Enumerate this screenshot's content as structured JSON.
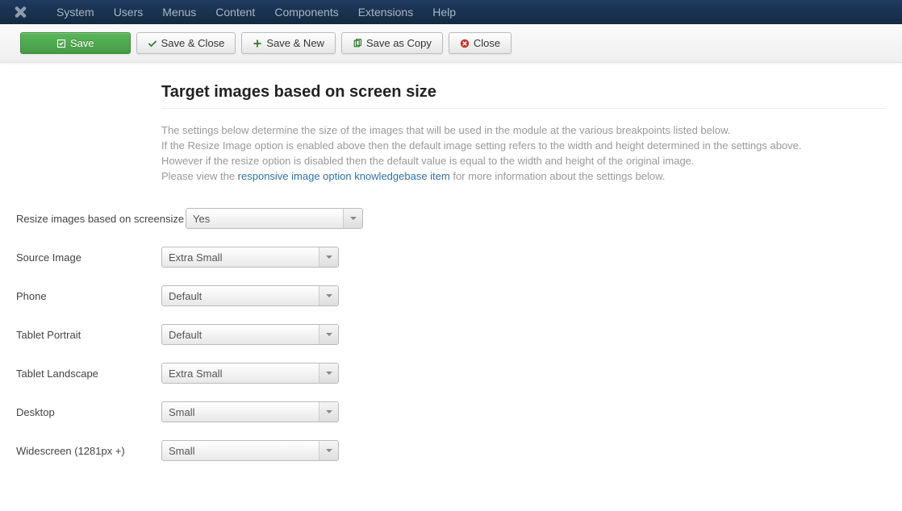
{
  "navbar": {
    "items": [
      "System",
      "Users",
      "Menus",
      "Content",
      "Components",
      "Extensions",
      "Help"
    ]
  },
  "toolbar": {
    "save": "Save",
    "save_close": "Save & Close",
    "save_new": "Save & New",
    "save_copy": "Save as Copy",
    "close": "Close"
  },
  "section": {
    "title": "Target images based on screen size",
    "desc_line1": "The settings below determine the size of the images that will be used in the module at the various breakpoints listed below.",
    "desc_line2": "If the Resize Image option is enabled above then the default image setting refers to the width and height determined in the settings above.",
    "desc_line3": "However if the resize option is disabled then the default value is equal to the width and height of the original image.",
    "desc_line4_pre": "Please view the ",
    "desc_line4_link": "responsive image option knowledgebase item",
    "desc_line4_post": " for more information about the settings below."
  },
  "form": {
    "resize_label": "Resize images based on screensize",
    "resize_value": "Yes",
    "source_label": "Source Image",
    "source_value": "Extra Small",
    "phone_label": "Phone",
    "phone_value": "Default",
    "tablet_portrait_label": "Tablet Portrait",
    "tablet_portrait_value": "Default",
    "tablet_landscape_label": "Tablet Landscape",
    "tablet_landscape_value": "Extra Small",
    "desktop_label": "Desktop",
    "desktop_value": "Small",
    "widescreen_label": "Widescreen (1281px +)",
    "widescreen_value": "Small"
  }
}
